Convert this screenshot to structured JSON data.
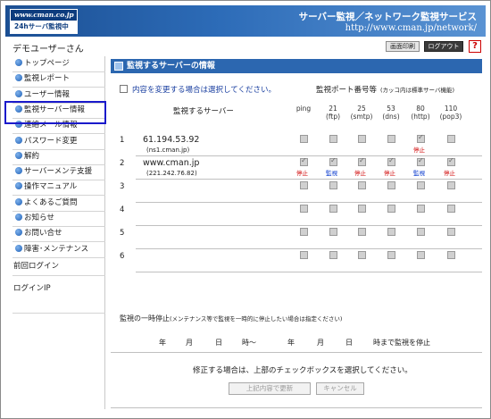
{
  "header": {
    "logo_url": "www.cman.co.jp",
    "logo_sub": "24hサーバ監視中",
    "title": "サーバー監視／ネットワーク監視サービス",
    "url": "http://www.cman.jp/network/"
  },
  "user": {
    "name": "デモユーザーさん"
  },
  "toolbar": {
    "print_label": "画面印刷",
    "logout_label": "ログアウト",
    "help_label": "?"
  },
  "sidebar": {
    "items": [
      {
        "label": "トップページ"
      },
      {
        "label": "監視レポート"
      },
      {
        "label": "ユーザー情報"
      },
      {
        "label": "監視サーバー情報"
      },
      {
        "label": "連絡メール情報"
      },
      {
        "label": "パスワード変更"
      },
      {
        "label": "解約"
      },
      {
        "label": "サーバーメンテ支援"
      },
      {
        "label": "操作マニュアル"
      },
      {
        "label": "よくあるご質問"
      },
      {
        "label": "お知らせ"
      },
      {
        "label": "お問い合せ"
      },
      {
        "label": "障害･メンテナンス"
      }
    ],
    "prev_login_label": "前回ログイン",
    "login_ip_label": "ログインIP"
  },
  "main": {
    "title": "監視するサーバーの情報",
    "edit_checkbox_label": "内容を変更する場合は選択してください。",
    "ports_title": "監視ポート番号等",
    "ports_note": "(カッコ内は標準サーバ機能)",
    "server_col_header": "監視するサーバー",
    "ports": [
      {
        "num": "ping",
        "proto": ""
      },
      {
        "num": "21",
        "proto": "(ftp)"
      },
      {
        "num": "25",
        "proto": "(smtp)"
      },
      {
        "num": "53",
        "proto": "(dns)"
      },
      {
        "num": "80",
        "proto": "(http)"
      },
      {
        "num": "110",
        "proto": "(pop3)"
      }
    ],
    "rows": [
      {
        "num": "1",
        "host": "61.194.53.92",
        "sub": "(ns1.cman.jp)",
        "cells": [
          {
            "c": false,
            "s": ""
          },
          {
            "c": false,
            "s": ""
          },
          {
            "c": false,
            "s": ""
          },
          {
            "c": false,
            "s": ""
          },
          {
            "c": true,
            "s": "停止"
          },
          {
            "c": false,
            "s": ""
          }
        ]
      },
      {
        "num": "2",
        "host": "www.cman.jp",
        "sub": "(221.242.76.82)",
        "cells": [
          {
            "c": true,
            "s": "停止"
          },
          {
            "c": true,
            "s": "監視"
          },
          {
            "c": true,
            "s": "停止"
          },
          {
            "c": true,
            "s": "停止"
          },
          {
            "c": true,
            "s": "監視"
          },
          {
            "c": true,
            "s": "停止"
          }
        ]
      },
      {
        "num": "3",
        "host": "",
        "sub": "",
        "cells": [
          {
            "c": false,
            "s": ""
          },
          {
            "c": false,
            "s": ""
          },
          {
            "c": false,
            "s": ""
          },
          {
            "c": false,
            "s": ""
          },
          {
            "c": false,
            "s": ""
          },
          {
            "c": false,
            "s": ""
          }
        ]
      },
      {
        "num": "4",
        "host": "",
        "sub": "",
        "cells": [
          {
            "c": false,
            "s": ""
          },
          {
            "c": false,
            "s": ""
          },
          {
            "c": false,
            "s": ""
          },
          {
            "c": false,
            "s": ""
          },
          {
            "c": false,
            "s": ""
          },
          {
            "c": false,
            "s": ""
          }
        ]
      },
      {
        "num": "5",
        "host": "",
        "sub": "",
        "cells": [
          {
            "c": false,
            "s": ""
          },
          {
            "c": false,
            "s": ""
          },
          {
            "c": false,
            "s": ""
          },
          {
            "c": false,
            "s": ""
          },
          {
            "c": false,
            "s": ""
          },
          {
            "c": false,
            "s": ""
          }
        ]
      },
      {
        "num": "6",
        "host": "",
        "sub": "",
        "cells": [
          {
            "c": false,
            "s": ""
          },
          {
            "c": false,
            "s": ""
          },
          {
            "c": false,
            "s": ""
          },
          {
            "c": false,
            "s": ""
          },
          {
            "c": false,
            "s": ""
          },
          {
            "c": false,
            "s": ""
          }
        ]
      }
    ],
    "suspend": {
      "title": "監視の一時停止",
      "note": "(メンテナンス等で監視を一時的に停止したい場合は指定ください)",
      "year": "年",
      "month": "月",
      "day": "日",
      "hour_from": "時～",
      "year2": "年",
      "month2": "月",
      "day2": "日",
      "hour_to": "時まで監視を停止"
    },
    "footer_note": "修正する場合は、上部のチェックボックスを選択してください。",
    "update_button": "上記内容で更新",
    "cancel_button": "キャンセル"
  },
  "colors": {
    "accent": "#2c67b0",
    "stop": "#d00000",
    "monitor": "#0033cc",
    "selected_outline": "#1a1acb"
  },
  "icons": {
    "menu_bullet": "blue-circle-bullet",
    "section": "grid-icon",
    "help": "help-icon"
  }
}
